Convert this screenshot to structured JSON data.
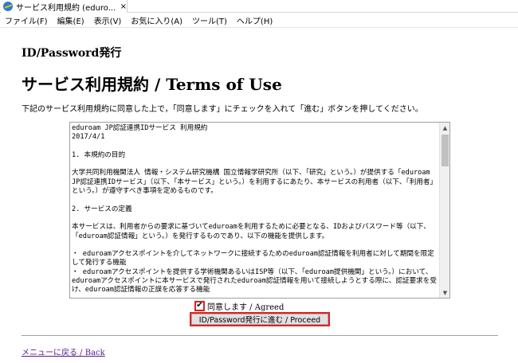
{
  "window": {
    "tab_title": "サービス利用規約 (eduro...",
    "close_glyph": "×"
  },
  "menu": {
    "items": [
      "ファイル(F)",
      "編集(E)",
      "表示(V)",
      "お気に入り(A)",
      "ツール(T)",
      "ヘルプ(H)"
    ]
  },
  "page": {
    "heading_small": "ID/Password発行",
    "heading_large": "サービス利用規約 / Terms of Use",
    "instruction": "下記のサービス利用規約に同意した上で，「同意します」にチェックを入れて「進む」ボタンを押してください。",
    "terms_text": "eduroam JP認証連携IDサービス 利用規約\n2017/4/1\n\n1. 本規約の目的\n\n大学共同利用機関法人 情報・システム研究機構 国立情報学研究所（以下、「研究」という。）が提供する「eduroam JP認証連携IDサービス」（以下、「本サービス」という。）を利用するにあたり、本サービスの利用者（以下、「利用者」という。）が遵守すべき事項を定めるものです。\n\n2. サービスの定義\n\n本サービスは、利用者からの要求に基づいてeduroamを利用するために必要となる、IDおよびパスワード等（以下、「eduroam認証情報」という。）を発行するものであり、以下の機能を提供します。\n\n・ eduroamアクセスポイントを介してネットワークに接続するためのeduroam認証情報を利用者に対して期間を限定して発行する機能\n・ eduroamアクセスポイントを提供する学術機関あるいはISP等（以下、「eduroam提供機関」という。）において、eduroamアクセスポイントに本サービスで発行されたeduroam認証情報を用いて接続しようとする際に、認証要求を受け、eduroam認証情報の正誤を応答する機能",
    "agree_label_ja": "同意します",
    "agree_label_en": " / Agreed",
    "agree_checked_glyph": "✔",
    "proceed_label": "ID/Password発行に進む / Proceed",
    "back_label_ja": "メニューに戻る",
    "back_label_en": " / Back"
  },
  "icons": {
    "tab_icon": "ie-browser-icon",
    "scroll_up": "scroll-up-arrow-icon",
    "scroll_down": "scroll-down-arrow-icon"
  },
  "colors": {
    "highlight_border": "#e02020",
    "link_visited": "#551a8b"
  }
}
